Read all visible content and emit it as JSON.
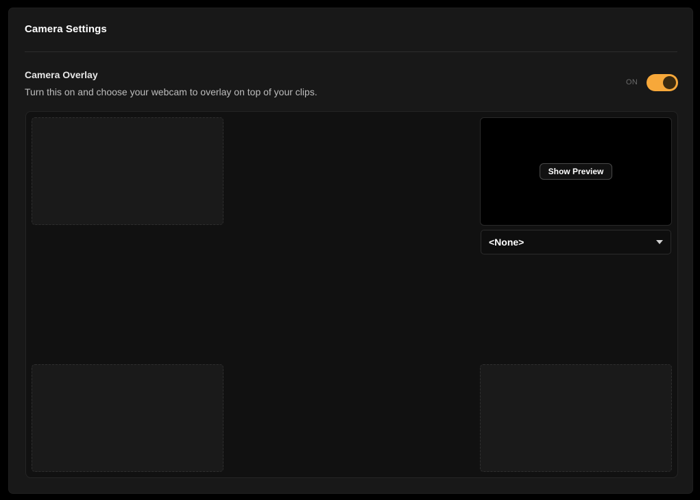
{
  "panel": {
    "title": "Camera Settings"
  },
  "camera_overlay": {
    "label": "Camera Overlay",
    "description": "Turn this on and choose your webcam to overlay on top of your clips.",
    "toggle_state_label": "ON",
    "toggle_on": true
  },
  "preview": {
    "show_preview_label": "Show Preview"
  },
  "camera_select": {
    "selected": "<None>"
  },
  "colors": {
    "accent": "#f7a83a",
    "panel_bg": "#181818",
    "stage_bg": "#111111"
  }
}
